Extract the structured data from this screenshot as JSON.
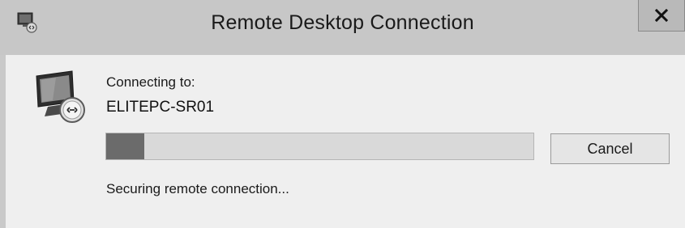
{
  "window": {
    "title": "Remote Desktop Connection",
    "close_label": "X"
  },
  "dialog": {
    "connecting_label": "Connecting to:",
    "host": "ELITEPC-SR01",
    "progress_fraction": 0.09,
    "cancel_label": "Cancel",
    "status_text": "Securing remote connection..."
  },
  "icons": {
    "app": "remote-desktop-icon",
    "dialog": "monitor-connection-icon",
    "close": "close-icon"
  }
}
